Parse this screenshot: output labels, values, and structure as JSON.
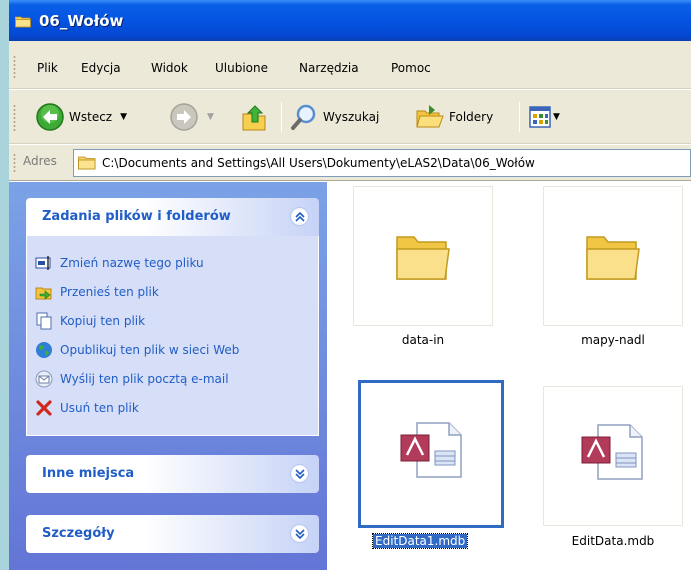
{
  "window": {
    "title": "06_Wołów"
  },
  "menu": [
    "Plik",
    "Edycja",
    "Widok",
    "Ulubione",
    "Narzędzia",
    "Pomoc"
  ],
  "toolbar": {
    "back_label": "Wstecz",
    "search_label": "Wyszukaj",
    "folders_label": "Foldery"
  },
  "address": {
    "label": "Adres",
    "path": "C:\\Documents and Settings\\All Users\\Dokumenty\\eLAS2\\Data\\06_Wołów"
  },
  "taskpane": {
    "file_tasks": {
      "title": "Zadania plików i folderów",
      "items": [
        {
          "label": "Zmień nazwę tego pliku",
          "icon": "rename-icon"
        },
        {
          "label": "Przenieś ten plik",
          "icon": "move-icon"
        },
        {
          "label": "Kopiuj ten plik",
          "icon": "copy-icon"
        },
        {
          "label": "Opublikuj ten plik w sieci Web",
          "icon": "publish-web-icon"
        },
        {
          "label": "Wyślij ten plik pocztą e-mail",
          "icon": "email-icon"
        },
        {
          "label": "Usuń ten plik",
          "icon": "delete-icon"
        }
      ]
    },
    "other_places": {
      "title": "Inne miejsca"
    },
    "details": {
      "title": "Szczegóły"
    }
  },
  "files": [
    {
      "name": "data-in",
      "type": "folder",
      "selected": false
    },
    {
      "name": "mapy-nadl",
      "type": "folder",
      "selected": false
    },
    {
      "name": "EditData1.mdb",
      "type": "access-db",
      "selected": true
    },
    {
      "name": "EditData.mdb",
      "type": "access-db",
      "selected": false
    }
  ],
  "colors": {
    "titlebar": "#0554e3",
    "taskpane": "#6f8fe0",
    "task_link": "#215dc6",
    "selection": "#316ac5"
  }
}
